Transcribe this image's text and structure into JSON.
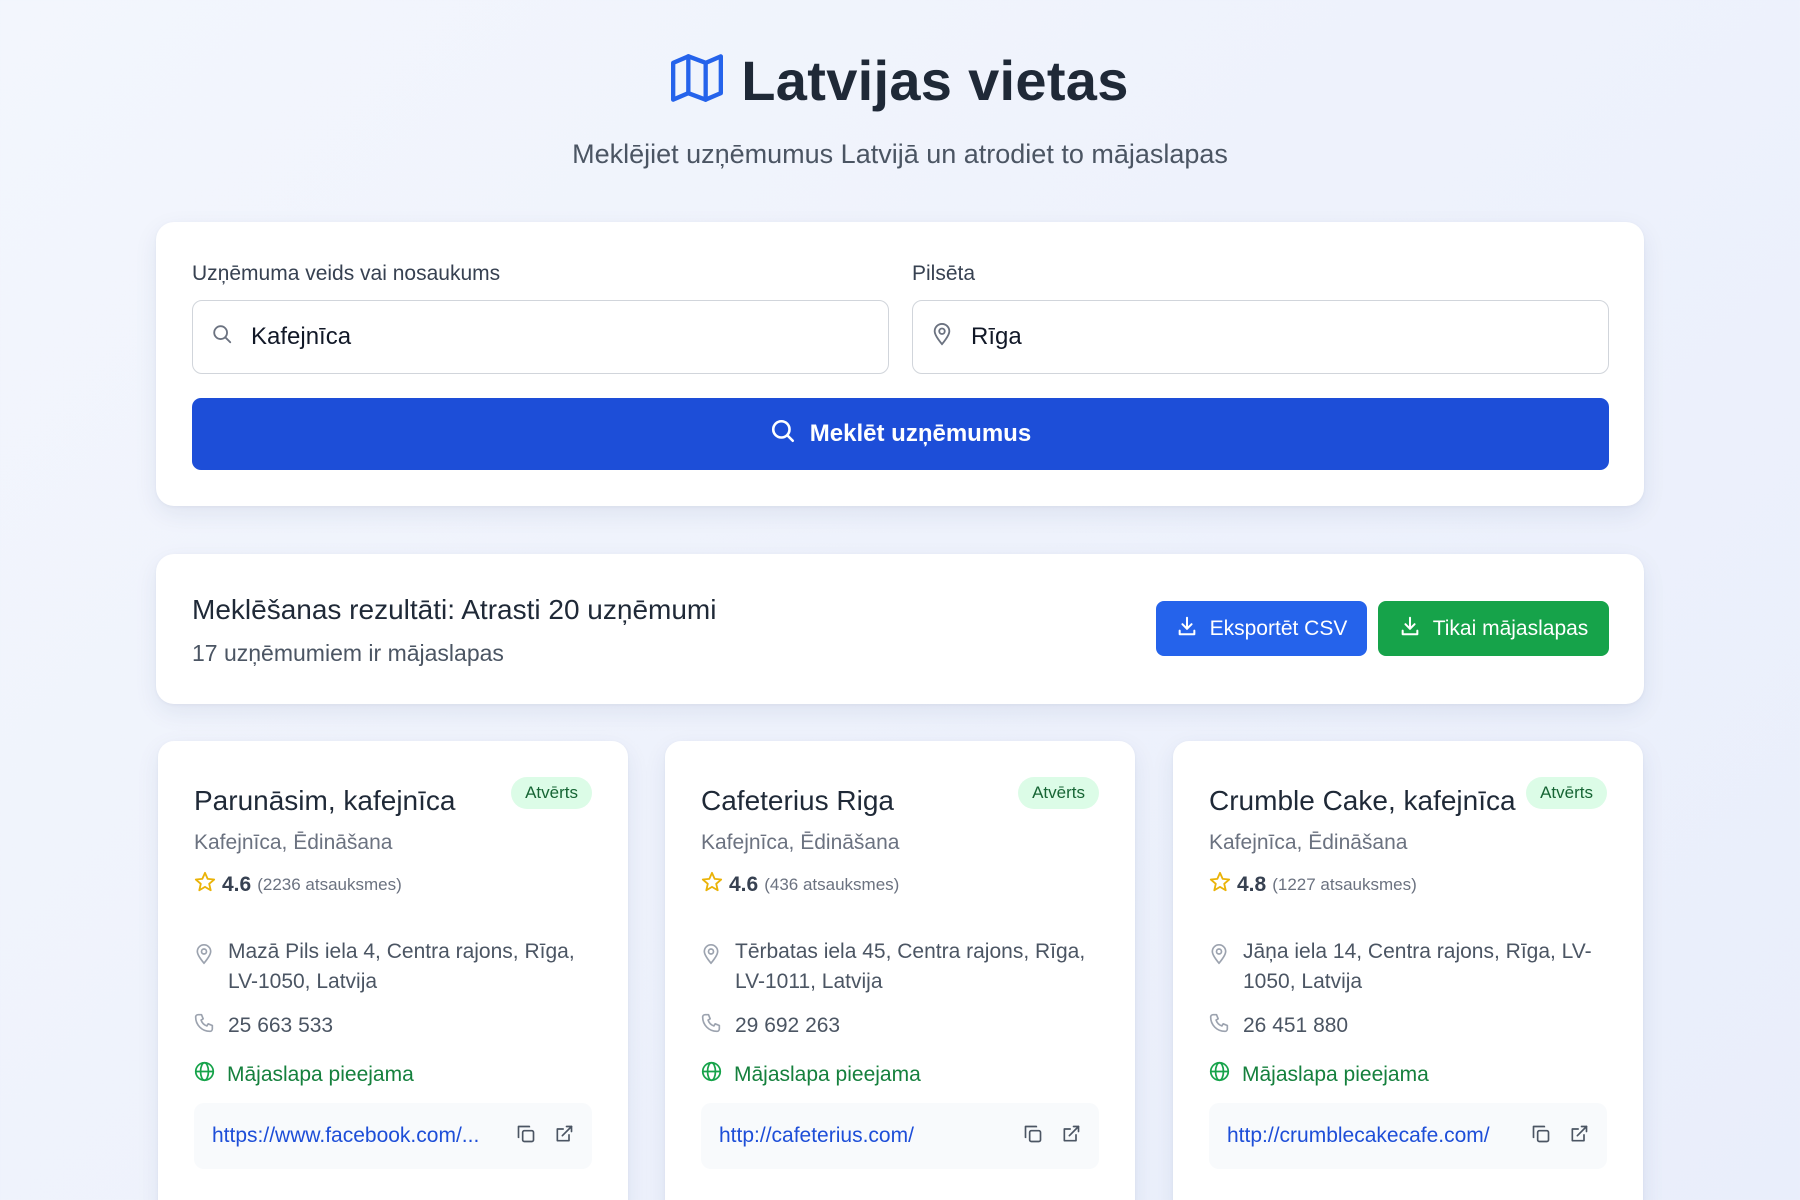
{
  "header": {
    "title": "Latvijas vietas",
    "subtitle": "Meklējiet uzņēmumus Latvijā un atrodiet to mājaslapas"
  },
  "search": {
    "business_label": "Uzņēmuma veids vai nosaukums",
    "business_value": "Kafejnīca",
    "city_label": "Pilsēta",
    "city_value": "Rīga",
    "button_label": "Meklēt uzņēmumus"
  },
  "results": {
    "title": "Meklēšanas rezultāti: Atrasti 20 uzņēmumi",
    "subtitle": "17 uzņēmumiem ir mājaslapas",
    "export_csv_label": "Eksportēt CSV",
    "websites_only_label": "Tikai mājaslapas"
  },
  "cards": [
    {
      "name": "Parunāsim, kafejnīca",
      "status": "Atvērts",
      "category": "Kafejnīca, Ēdināšana",
      "rating": "4.6",
      "reviews": "(2236 atsauksmes)",
      "address": "Mazā Pils iela 4, Centra rajons, Rīga, LV-1050, Latvija",
      "phone": "25 663 533",
      "website_status": "Mājaslapa pieejama",
      "url": "https://www.facebook.com/..."
    },
    {
      "name": "Cafeterius Riga",
      "status": "Atvērts",
      "category": "Kafejnīca, Ēdināšana",
      "rating": "4.6",
      "reviews": "(436 atsauksmes)",
      "address": "Tērbatas iela 45, Centra rajons, Rīga, LV-1011, Latvija",
      "phone": "29 692 263",
      "website_status": "Mājaslapa pieejama",
      "url": "http://cafeterius.com/"
    },
    {
      "name": "Crumble Cake, kafejnīca",
      "status": "Atvērts",
      "category": "Kafejnīca, Ēdināšana",
      "rating": "4.8",
      "reviews": "(1227 atsauksmes)",
      "address": "Jāņa iela 14, Centra rajons, Rīga, LV-1050, Latvija",
      "phone": "26 451 880",
      "website_status": "Mājaslapa pieejama",
      "url": "http://crumblecakecafe.com/"
    }
  ],
  "colors": {
    "primary": "#1d4ed8",
    "export_button": "#2563eb",
    "success": "#16a34a",
    "badge_bg": "#dcfce7",
    "star": "#eab308"
  },
  "icons": [
    "map-icon",
    "search-icon",
    "location-pin-icon",
    "download-icon",
    "star-icon",
    "phone-icon",
    "globe-icon",
    "copy-icon",
    "external-link-icon"
  ]
}
